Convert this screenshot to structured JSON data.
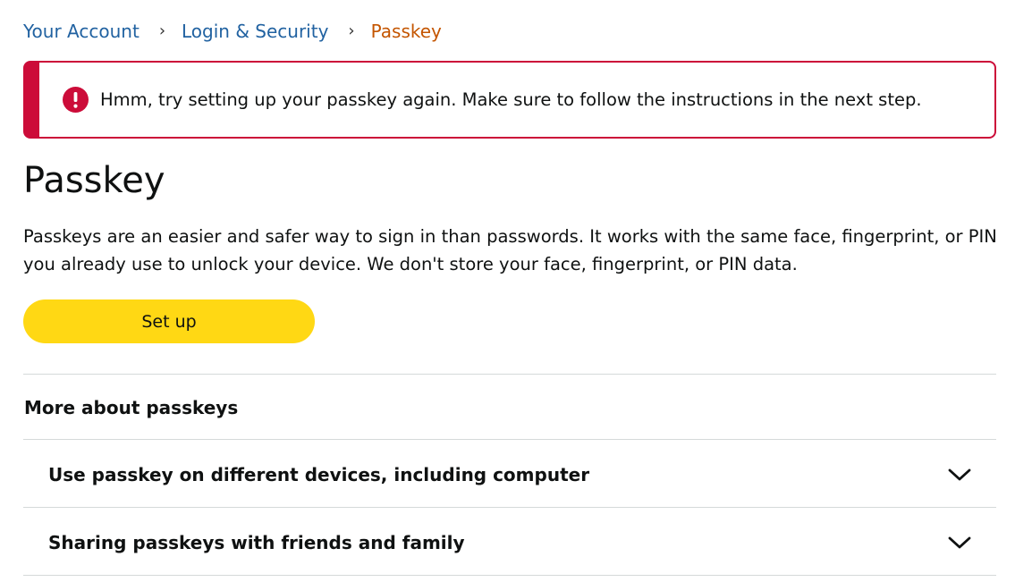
{
  "breadcrumb": {
    "items": [
      {
        "label": "Your Account"
      },
      {
        "label": "Login & Security"
      },
      {
        "label": "Passkey"
      }
    ],
    "separator": "›"
  },
  "alert": {
    "message": "Hmm, try setting up your passkey again. Make sure to follow the instructions in the next step.",
    "icon": "error-icon",
    "color": "#cc0c39"
  },
  "page": {
    "title": "Passkey",
    "description": "Passkeys are an easier and safer way to sign in than passwords. It works with the same face, fingerprint, or PIN you already use to unlock your device. We don't store your face, fingerprint, or PIN data."
  },
  "actions": {
    "setup_label": "Set up",
    "button_color": "#ffd814"
  },
  "more": {
    "heading": "More about passkeys",
    "items": [
      {
        "label": "Use passkey on different devices, including computer",
        "expanded": false
      },
      {
        "label": "Sharing passkeys with friends and family",
        "expanded": false
      }
    ]
  },
  "colors": {
    "link": "#2162a1",
    "current_crumb": "#c45500",
    "divider": "#d5d9d9"
  }
}
